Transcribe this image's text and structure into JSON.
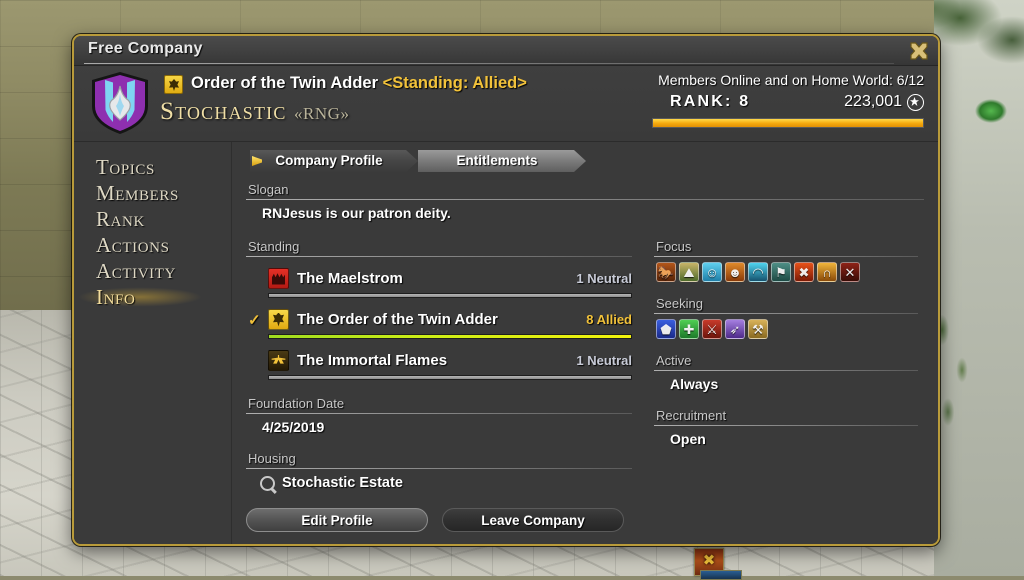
{
  "window": {
    "title": "Free Company",
    "close_icon": "close-x-icon"
  },
  "header": {
    "grand_company_badge": "twin-adder-badge-icon",
    "grand_company_name": "Order of the Twin Adder",
    "standing_tag": "<Standing: Allied>",
    "company_name": "Stochastic",
    "company_tag": "«RNG»",
    "members_online": "Members Online and on Home World: 6/12",
    "rank_label": "RANK: 8",
    "rank_points": "223,001",
    "rank_star_icon": "rank-star-icon",
    "rank_bar_percent": 100
  },
  "sidebar": {
    "items": [
      {
        "label": "Topics",
        "selected": false
      },
      {
        "label": "Members",
        "selected": false
      },
      {
        "label": "Rank",
        "selected": false
      },
      {
        "label": "Actions",
        "selected": false
      },
      {
        "label": "Activity",
        "selected": false
      },
      {
        "label": "Info",
        "selected": true
      }
    ]
  },
  "tabs": [
    {
      "label": "Company Profile",
      "active": true
    },
    {
      "label": "Entitlements",
      "active": false
    }
  ],
  "slogan": {
    "label": "Slogan",
    "value": "RNJesus is our patron deity."
  },
  "standing": {
    "label": "Standing",
    "rows": [
      {
        "name": "The Maelstrom",
        "rank": "1 Neutral",
        "rank_color": "#c9ccd8",
        "selected": false,
        "icon": "maelstrom-icon",
        "bar_percent": 100,
        "bar_style": "grey"
      },
      {
        "name": "The Order of the Twin Adder",
        "rank": "8 Allied",
        "rank_color": "#f2c23a",
        "selected": true,
        "icon": "twin-adder-icon",
        "bar_percent": 100,
        "bar_style": "yellow"
      },
      {
        "name": "The Immortal Flames",
        "rank": "1 Neutral",
        "rank_color": "#c9ccd8",
        "selected": false,
        "icon": "immortal-flames-icon",
        "bar_percent": 100,
        "bar_style": "grey"
      }
    ]
  },
  "foundation_date": {
    "label": "Foundation Date",
    "value": "4/25/2019"
  },
  "housing": {
    "label": "Housing",
    "search_icon": "magnifier-icon",
    "value": "Stochastic Estate"
  },
  "focus": {
    "label": "Focus",
    "icons": [
      {
        "name": "role-playing-icon",
        "glyph": "🐎",
        "bg1": "#b4561a",
        "bg2": "#5a2408"
      },
      {
        "name": "leveling-icon",
        "glyph": "⛰",
        "bg1": "#c8b468",
        "bg2": "#4e6b2a"
      },
      {
        "name": "casual-icon",
        "glyph": "☺",
        "bg1": "#5fd0ef",
        "bg2": "#1f7fa8"
      },
      {
        "name": "hardcore-icon",
        "glyph": "☻",
        "bg1": "#e08a2a",
        "bg2": "#8a3a08"
      },
      {
        "name": "dungeons-icon",
        "glyph": "◠",
        "bg1": "#4fd4ef",
        "bg2": "#16526e"
      },
      {
        "name": "guildhests-icon",
        "glyph": "⚑",
        "bg1": "#4e8f86",
        "bg2": "#1d4a44"
      },
      {
        "name": "trials-icon",
        "glyph": "✖",
        "bg1": "#e8521a",
        "bg2": "#7d1a06"
      },
      {
        "name": "raids-icon",
        "glyph": "∩",
        "bg1": "#f0b43a",
        "bg2": "#8a4a08"
      },
      {
        "name": "pvp-icon",
        "glyph": "✕",
        "bg1": "#8e2216",
        "bg2": "#3a0c06"
      }
    ]
  },
  "seeking": {
    "label": "Seeking",
    "icons": [
      {
        "name": "tank-icon",
        "glyph": "⬟",
        "bg1": "#3a5fe0",
        "bg2": "#1a2a8a"
      },
      {
        "name": "healer-icon",
        "glyph": "✚",
        "bg1": "#4fcf52",
        "bg2": "#1d7a2a"
      },
      {
        "name": "melee-dps-icon",
        "glyph": "⚔",
        "bg1": "#c83a2a",
        "bg2": "#6e150c"
      },
      {
        "name": "ranged-dps-icon",
        "glyph": "➶",
        "bg1": "#a57fe0",
        "bg2": "#4e2a8a"
      },
      {
        "name": "crafter-icon",
        "glyph": "⚒",
        "bg1": "#d8b25a",
        "bg2": "#8a6a20"
      }
    ]
  },
  "active": {
    "label": "Active",
    "value": "Always"
  },
  "recruitment": {
    "label": "Recruitment",
    "value": "Open"
  },
  "footer": {
    "edit_profile": "Edit Profile",
    "leave_company": "Leave Company"
  }
}
